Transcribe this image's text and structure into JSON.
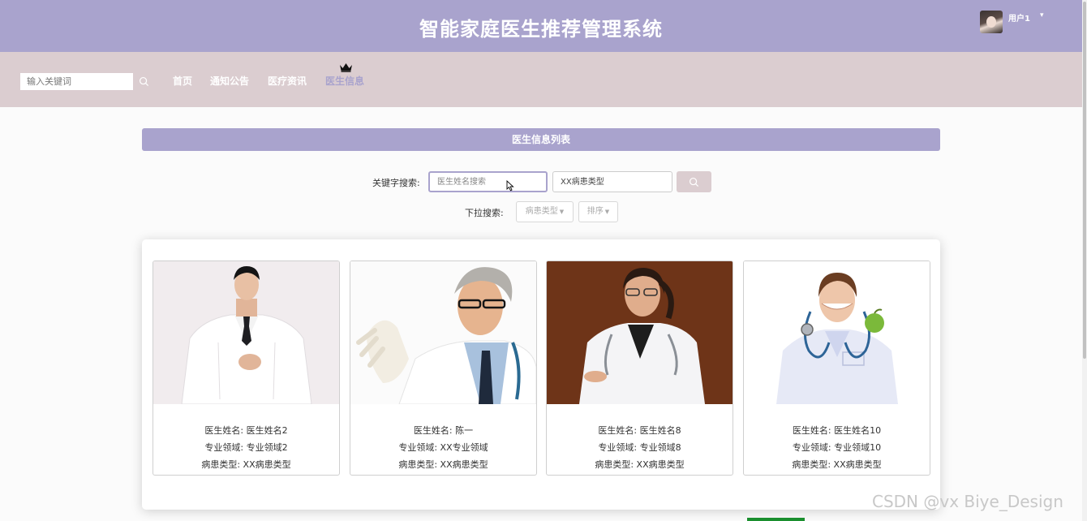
{
  "header": {
    "title": "智能家庭医生推荐管理系统",
    "username": "用户1",
    "user_caret": "▾"
  },
  "navbar": {
    "search_placeholder": "输入关键词",
    "items": [
      {
        "label": "首页"
      },
      {
        "label": "通知公告"
      },
      {
        "label": "医疗资讯"
      },
      {
        "label": "医生信息"
      }
    ],
    "active_index": 3
  },
  "main": {
    "list_title": "医生信息列表",
    "keyword_label": "关键字搜索:",
    "name_placeholder": "医生姓名搜索",
    "type_placeholder": "XX病患类型",
    "dropdown_label": "下拉搜索:",
    "dropdowns": [
      {
        "label": "病患类型"
      },
      {
        "label": "排序"
      }
    ]
  },
  "doctors": [
    {
      "name": "医生姓名: 医生姓名2",
      "field": "专业领域: 专业领域2",
      "patient_type": "病患类型: XX病患类型"
    },
    {
      "name": "医生姓名: 陈一",
      "field": "专业领域: XX专业领域",
      "patient_type": "病患类型: XX病患类型"
    },
    {
      "name": "医生姓名: 医生姓名8",
      "field": "专业领域: 专业领域8",
      "patient_type": "病患类型: XX病患类型"
    },
    {
      "name": "医生姓名: 医生姓名10",
      "field": "专业领域: 专业领域10",
      "patient_type": "病患类型: XX病患类型"
    }
  ],
  "watermark": "CSDN @vx Biye_Design",
  "colors": {
    "header_bg": "#a9a3cd",
    "nav_bg": "#dbcdd0",
    "accent": "#a9a3cd"
  }
}
